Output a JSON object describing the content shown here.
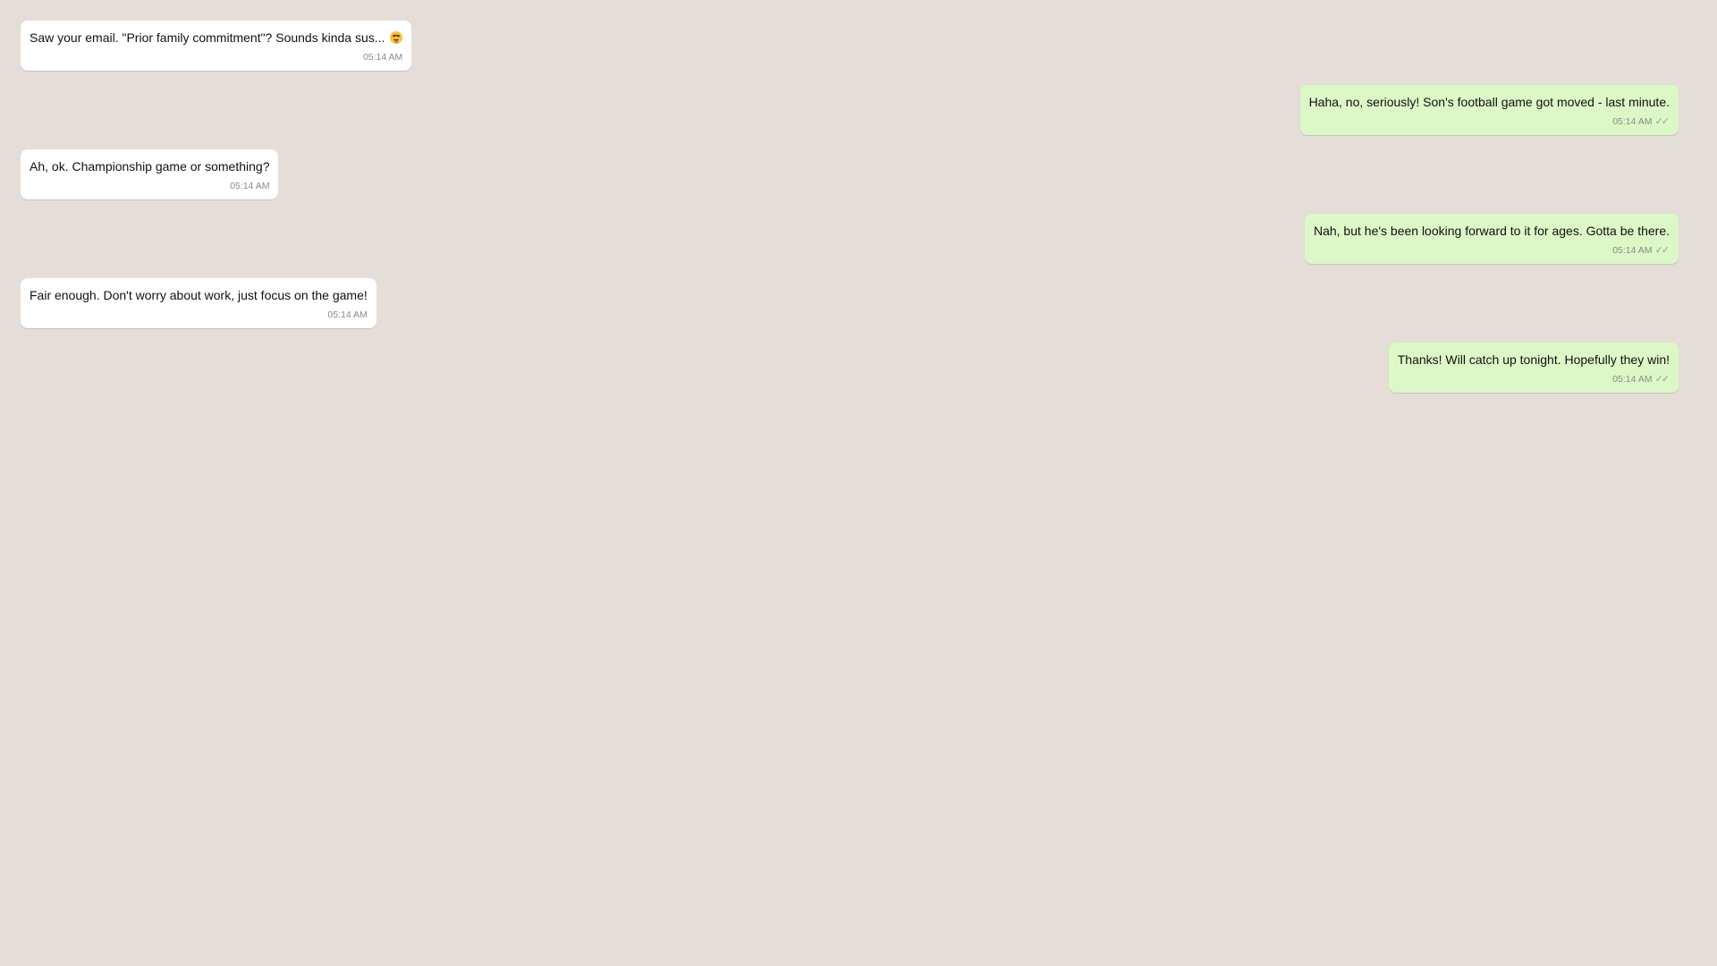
{
  "chat": {
    "messages": [
      {
        "direction": "incoming",
        "text": "Saw your email. \"Prior family commitment\"? Sounds kinda sus...",
        "emoji": "winking-face-with-tongue",
        "time": "05:14 AM"
      },
      {
        "direction": "outgoing",
        "text": "Haha, no, seriously! Son's football game got moved - last minute.",
        "time": "05:14 AM",
        "ticks": "✓✓"
      },
      {
        "direction": "incoming",
        "text": "Ah, ok. Championship game or something?",
        "time": "05:14 AM"
      },
      {
        "direction": "outgoing",
        "text": "Nah, but he's been looking forward to it for ages. Gotta be there.",
        "time": "05:14 AM",
        "ticks": "✓✓"
      },
      {
        "direction": "incoming",
        "text": "Fair enough. Don't worry about work, just focus on the game!",
        "time": "05:14 AM"
      },
      {
        "direction": "outgoing",
        "text": "Thanks! Will catch up tonight. Hopefully they win!",
        "time": "05:14 AM",
        "ticks": "✓✓"
      }
    ]
  },
  "colors": {
    "background": "#e5ddd8",
    "incoming_bubble": "#ffffff",
    "outgoing_bubble": "#dcf8c6",
    "meta_text": "#8a8a8a"
  }
}
